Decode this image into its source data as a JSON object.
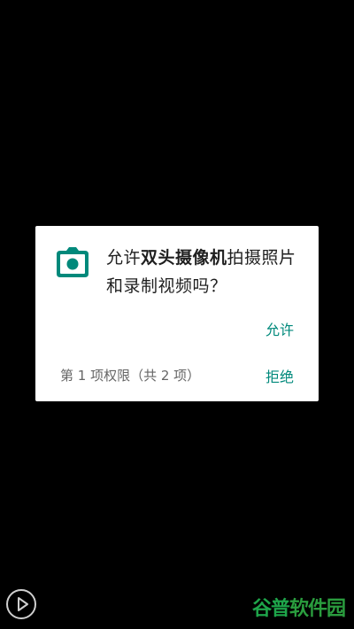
{
  "dialog": {
    "prompt_prefix": "允许",
    "app_name": "双头摄像机",
    "prompt_suffix": "拍摄照片和录制视频吗？",
    "allow_label": "允许",
    "deny_label": "拒绝",
    "permission_count": "第 1 项权限（共 2 项）",
    "icon": "camera-icon",
    "accent_color": "#00897b"
  },
  "overlay": {
    "play_icon": "play-icon",
    "watermark_part1": "谷普",
    "watermark_part2": "软件园",
    "watermark_color": "#1ea54a"
  }
}
